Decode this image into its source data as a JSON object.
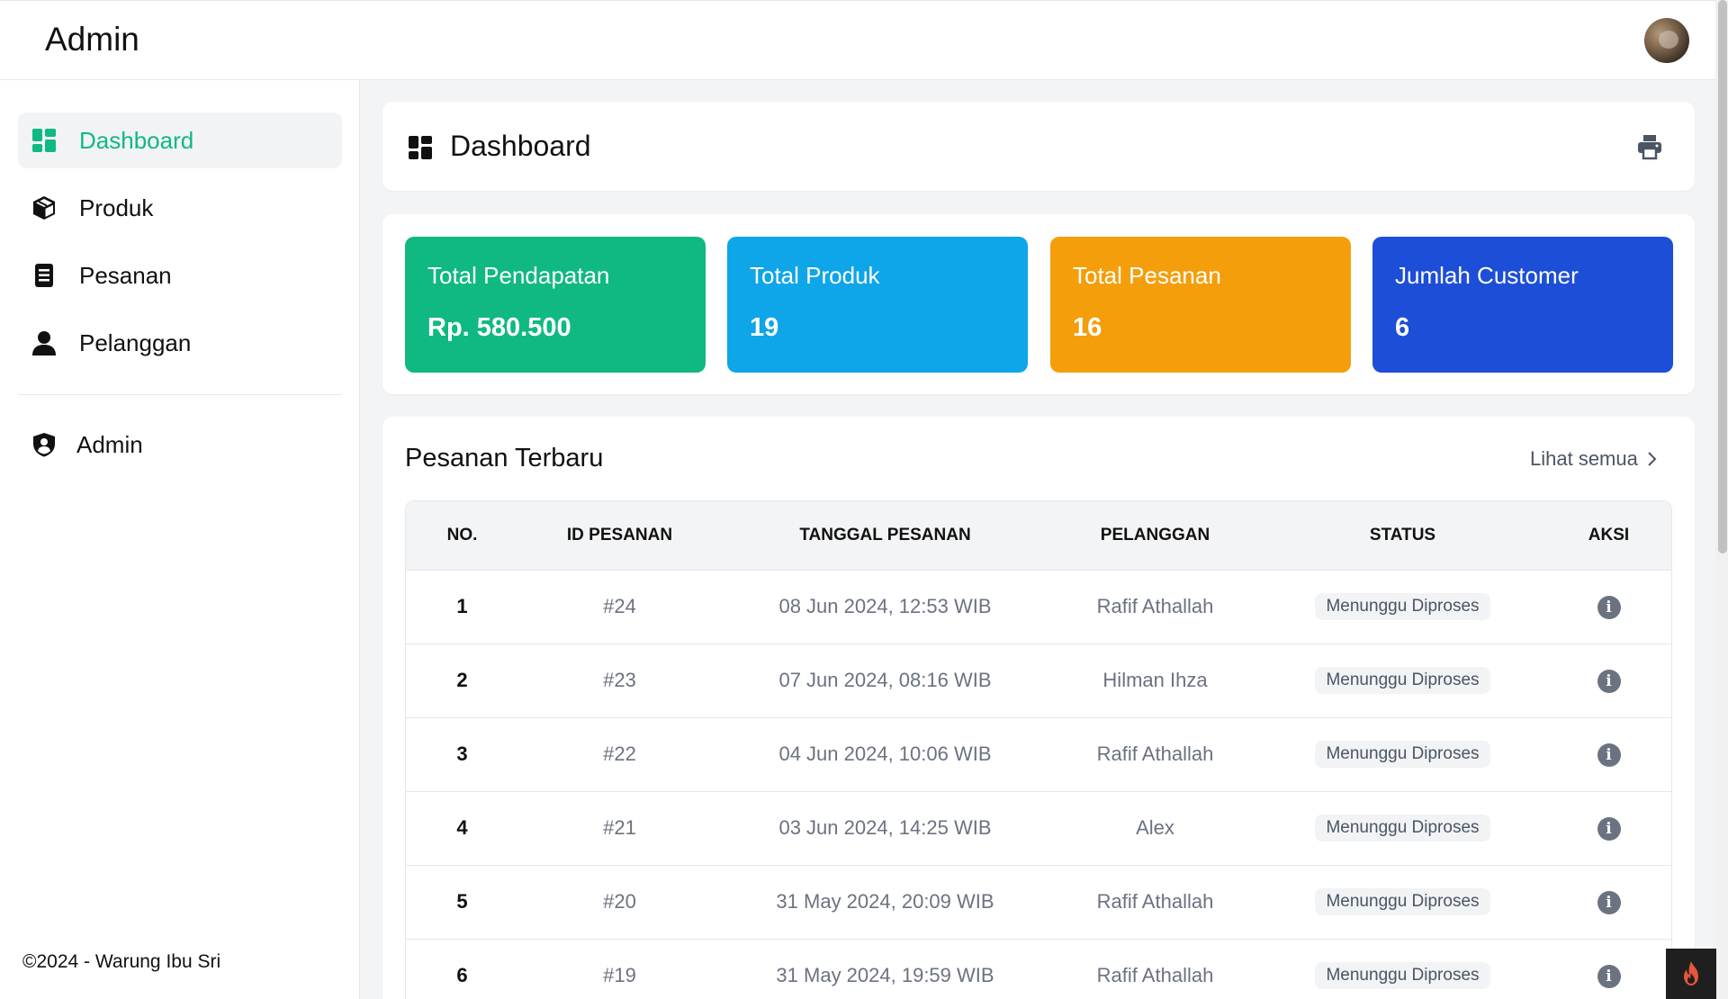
{
  "header": {
    "brand": "Admin"
  },
  "sidebar": {
    "items": [
      {
        "label": "Dashboard",
        "icon": "dashboard-grid-icon",
        "active": true
      },
      {
        "label": "Produk",
        "icon": "box-icon"
      },
      {
        "label": "Pesanan",
        "icon": "receipt-icon"
      },
      {
        "label": "Pelanggan",
        "icon": "user-icon"
      }
    ],
    "admin": {
      "label": "Admin",
      "icon": "shield-user-icon"
    },
    "footer": "©2024 - Warung Ibu Sri"
  },
  "page": {
    "title": "Dashboard",
    "print_icon": "printer-icon"
  },
  "stats": [
    {
      "title": "Total Pendapatan",
      "value": "Rp. 580.500",
      "color": "#10b981"
    },
    {
      "title": "Total Produk",
      "value": "19",
      "color": "#0ea5e9"
    },
    {
      "title": "Total Pesanan",
      "value": "16",
      "color": "#f59e0b"
    },
    {
      "title": "Jumlah Customer",
      "value": "6",
      "color": "#1d4ed8"
    }
  ],
  "orders": {
    "title": "Pesanan Terbaru",
    "see_all": "Lihat semua",
    "columns": [
      "NO.",
      "ID PESANAN",
      "TANGGAL PESANAN",
      "PELANGGAN",
      "STATUS",
      "AKSI"
    ],
    "rows": [
      {
        "no": "1",
        "id": "#24",
        "date": "08 Jun 2024, 12:53 WIB",
        "customer": "Rafif Athallah",
        "status": "Menunggu Diproses"
      },
      {
        "no": "2",
        "id": "#23",
        "date": "07 Jun 2024, 08:16 WIB",
        "customer": "Hilman Ihza",
        "status": "Menunggu Diproses"
      },
      {
        "no": "3",
        "id": "#22",
        "date": "04 Jun 2024, 10:06 WIB",
        "customer": "Rafif Athallah",
        "status": "Menunggu Diproses"
      },
      {
        "no": "4",
        "id": "#21",
        "date": "03 Jun 2024, 14:25 WIB",
        "customer": "Alex",
        "status": "Menunggu Diproses"
      },
      {
        "no": "5",
        "id": "#20",
        "date": "31 May 2024, 20:09 WIB",
        "customer": "Rafif Athallah",
        "status": "Menunggu Diproses"
      },
      {
        "no": "6",
        "id": "#19",
        "date": "31 May 2024, 19:59 WIB",
        "customer": "Rafif Athallah",
        "status": "Menunggu Diproses"
      }
    ]
  }
}
